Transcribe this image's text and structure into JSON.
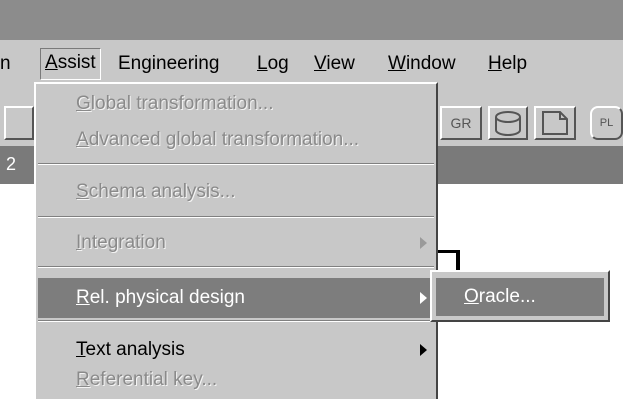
{
  "menubar": {
    "items": [
      {
        "label": "n",
        "mnemonic": ""
      },
      {
        "label": "Assist",
        "mnemonic": "A"
      },
      {
        "label": "Engineering",
        "mnemonic": ""
      },
      {
        "label": "Log",
        "mnemonic": "L"
      },
      {
        "label": "View",
        "mnemonic": "V"
      },
      {
        "label": "Window",
        "mnemonic": "W"
      },
      {
        "label": "Help",
        "mnemonic": "H"
      }
    ]
  },
  "toolbar": {
    "gr_label": "GR",
    "pl_label": "PL"
  },
  "darkbar": {
    "text": "2"
  },
  "assist_menu": {
    "items": [
      {
        "label": "Global transformation...",
        "enabled": false,
        "submenu": false
      },
      {
        "label": "Advanced global transformation...",
        "enabled": false,
        "submenu": false
      },
      {
        "label": "Schema analysis...",
        "enabled": false,
        "submenu": false
      },
      {
        "label": "Integration",
        "enabled": false,
        "submenu": true
      },
      {
        "label": "Rel. physical design",
        "enabled": true,
        "submenu": true,
        "highlighted": true
      },
      {
        "label": "Text analysis",
        "enabled": true,
        "submenu": true
      },
      {
        "label": "Referential key...",
        "enabled": false,
        "submenu": false
      }
    ]
  },
  "submenu": {
    "items": [
      {
        "label": "Oracle...",
        "highlighted": true
      }
    ]
  },
  "colors": {
    "menu_bg": "#c8c8c8",
    "highlight": "#7d7d7d",
    "disabled_text": "#8a8a8a",
    "titlebar": "#8c8c8c"
  }
}
